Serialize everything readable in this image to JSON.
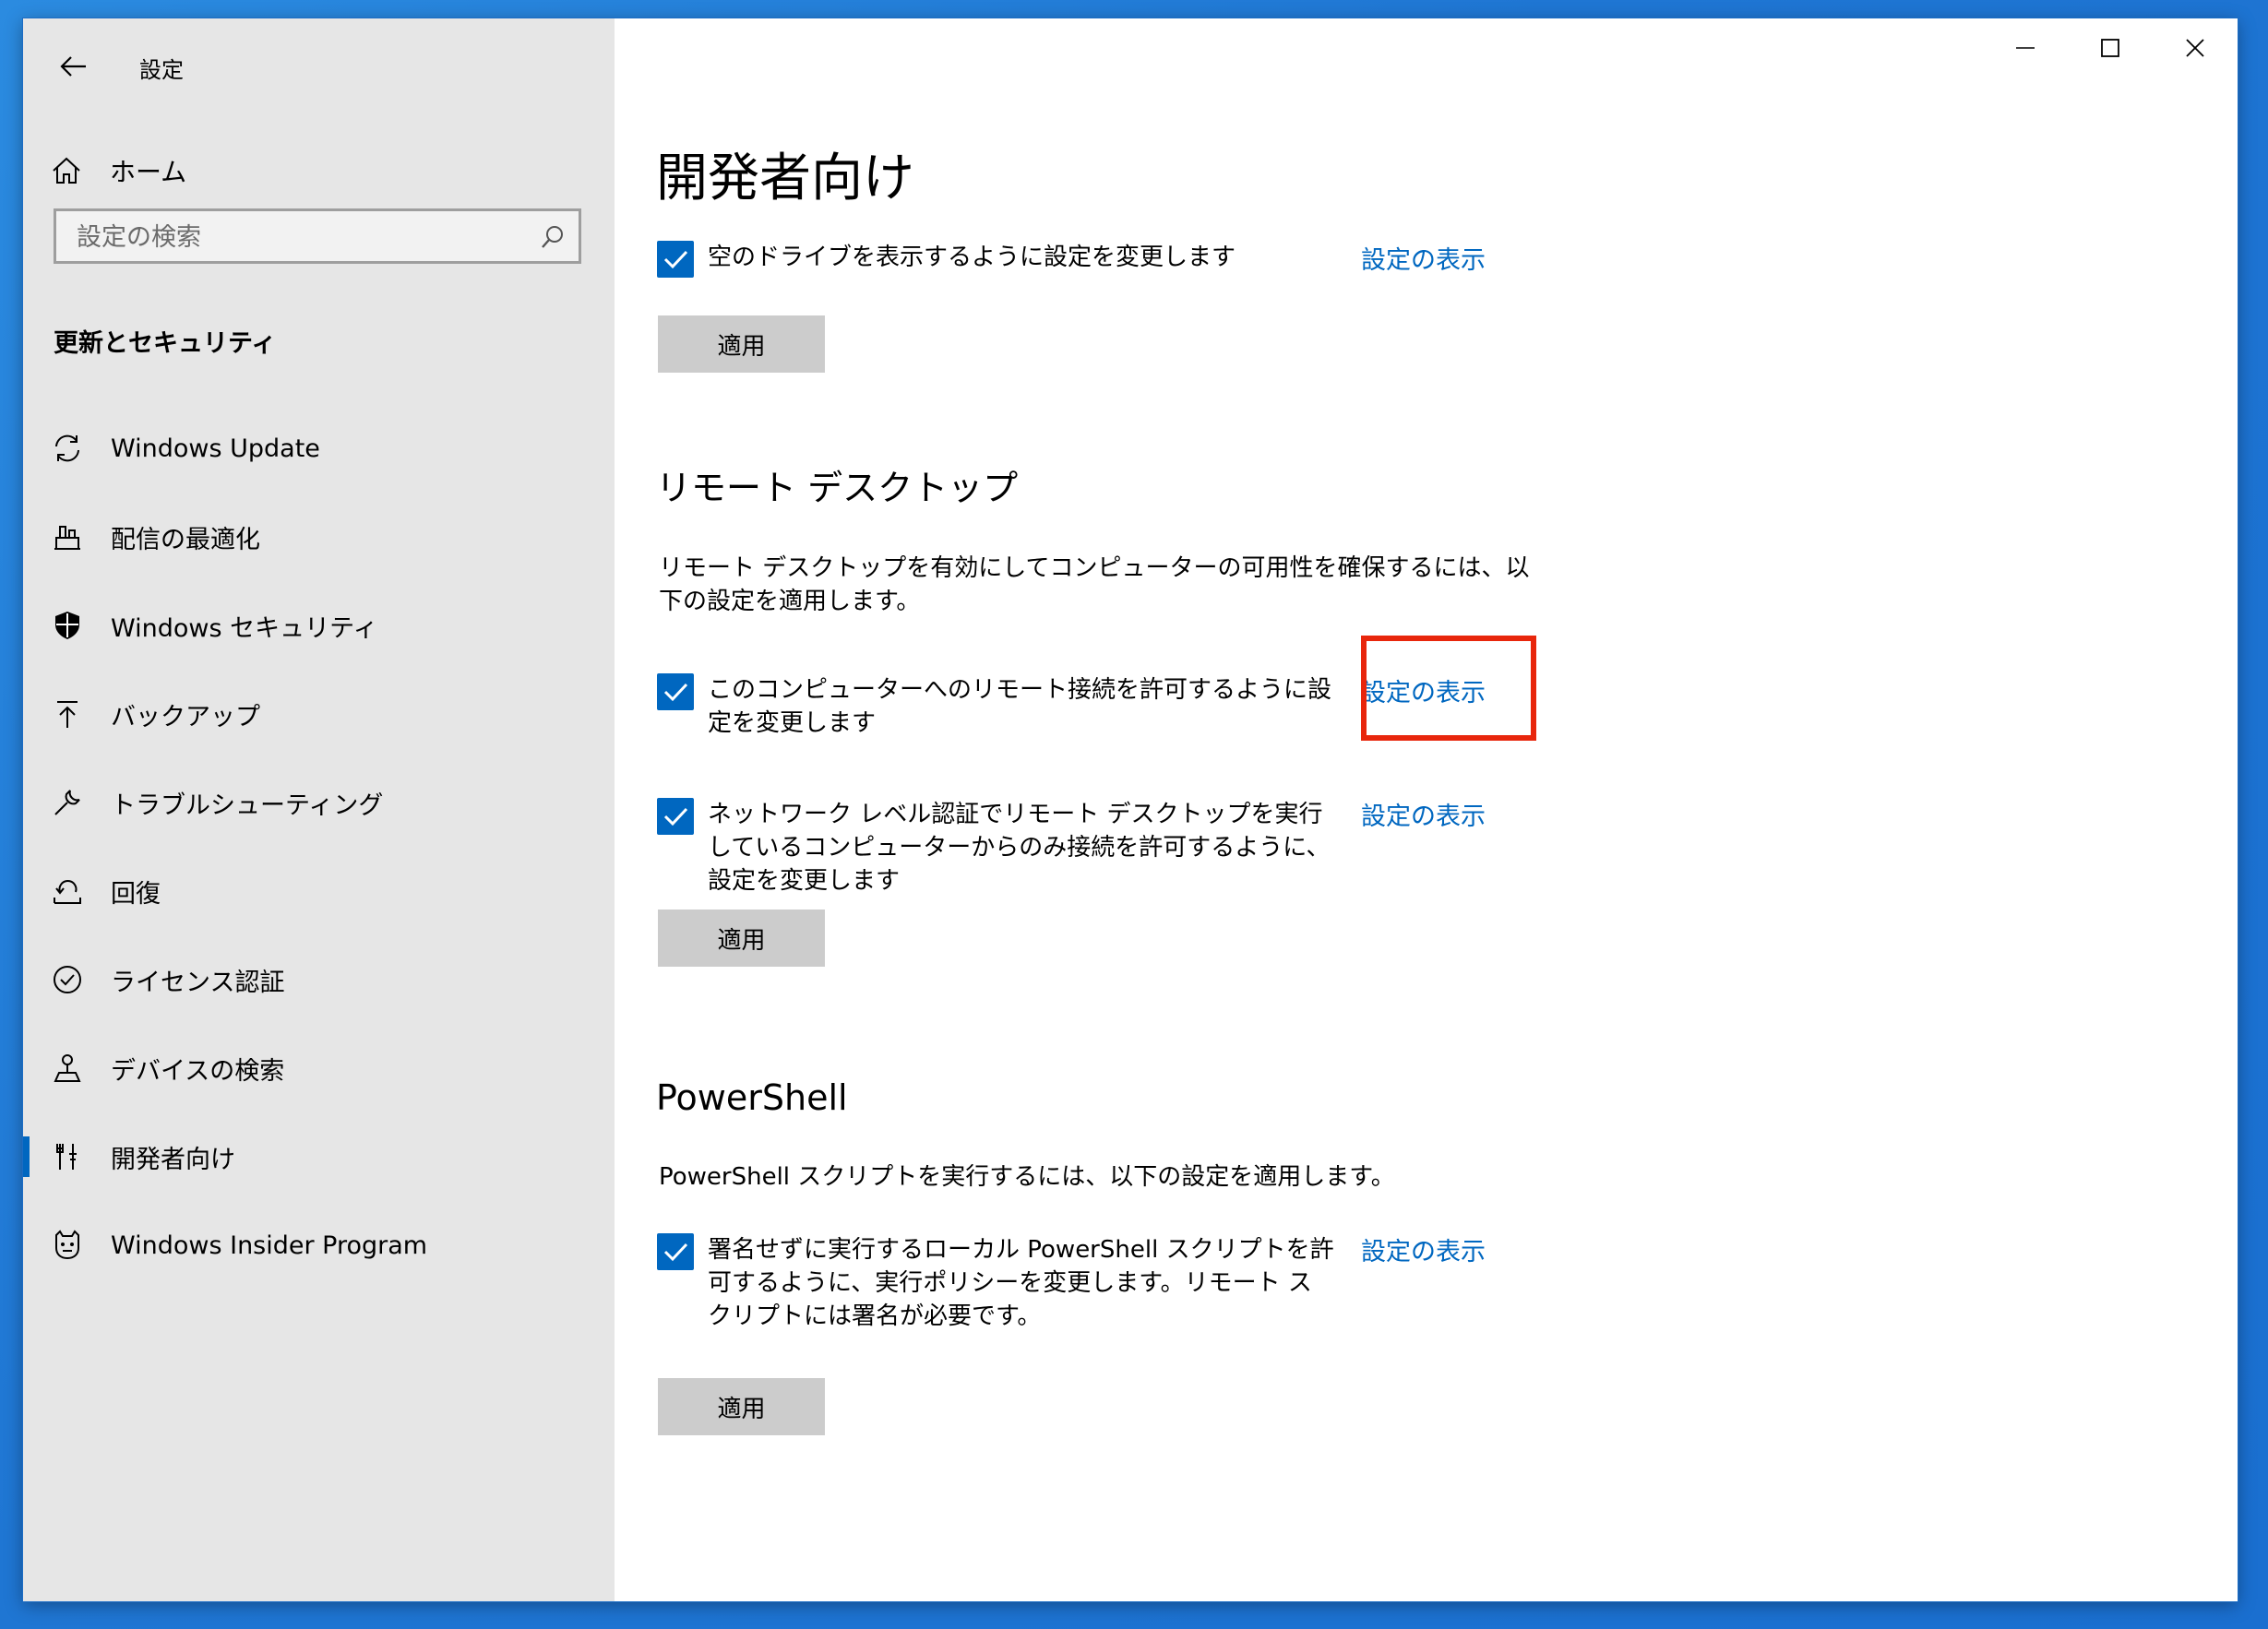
{
  "window": {
    "title": "設定"
  },
  "sidebar": {
    "home_label": "ホーム",
    "search_placeholder": "設定の検索",
    "section_title": "更新とセキュリティ",
    "items": [
      {
        "label": "Windows Update",
        "icon": "sync-icon"
      },
      {
        "label": "配信の最適化",
        "icon": "delivery-optimization-icon"
      },
      {
        "label": "Windows セキュリティ",
        "icon": "shield-icon"
      },
      {
        "label": "バックアップ",
        "icon": "backup-arrow-icon"
      },
      {
        "label": "トラブルシューティング",
        "icon": "wrench-icon"
      },
      {
        "label": "回復",
        "icon": "recovery-icon"
      },
      {
        "label": "ライセンス認証",
        "icon": "check-circle-icon"
      },
      {
        "label": "デバイスの検索",
        "icon": "find-device-icon"
      },
      {
        "label": "開発者向け",
        "icon": "developer-tools-icon",
        "active": true
      },
      {
        "label": "Windows Insider Program",
        "icon": "insider-cat-icon"
      }
    ]
  },
  "main": {
    "title": "開発者向け",
    "explorer": {
      "checkbox_label": "空のドライブを表示するように設定を変更します",
      "link": "設定の表示",
      "apply": "適用"
    },
    "remote_desktop": {
      "heading": "リモート デスクトップ",
      "description": "リモート デスクトップを有効にしてコンピューターの可用性を確保するには、以下の設定を適用します。",
      "options": [
        {
          "label": "このコンピューターへのリモート接続を許可するように設定を変更します",
          "link": "設定の表示",
          "checked": true
        },
        {
          "label": "ネットワーク レベル認証でリモート デスクトップを実行しているコンピューターからのみ接続を許可するように、設定を変更します",
          "link": "設定の表示",
          "checked": true
        }
      ],
      "apply": "適用"
    },
    "powershell": {
      "heading": "PowerShell",
      "description": "PowerShell スクリプトを実行するには、以下の設定を適用します。",
      "option": {
        "label": "署名せずに実行するローカル PowerShell スクリプトを許可するように、実行ポリシーを変更します。リモート スクリプトには署名が必要です。",
        "link": "設定の表示",
        "checked": true
      },
      "apply": "適用"
    }
  },
  "colors": {
    "accent": "#0067c0",
    "highlight": "#e8260c",
    "sidebar_bg": "#e6e6e6",
    "button_bg": "#cccccc"
  }
}
